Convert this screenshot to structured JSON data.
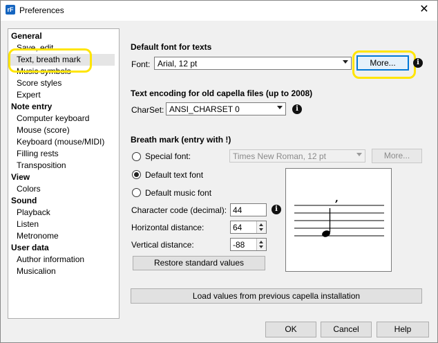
{
  "window": {
    "title": "Preferences",
    "app_icon_text": "rF"
  },
  "nav": {
    "groups": [
      {
        "label": "General",
        "items": [
          "Save, edit",
          "Text, breath mark",
          "Music symbols",
          "Score styles",
          "Expert"
        ]
      },
      {
        "label": "Note entry",
        "items": [
          "Computer keyboard",
          "Mouse (score)",
          "Keyboard (mouse/MIDI)",
          "Filling rests",
          "Transposition"
        ]
      },
      {
        "label": "View",
        "items": [
          "Colors"
        ]
      },
      {
        "label": "Sound",
        "items": [
          "Playback",
          "Listen",
          "Metronome"
        ]
      },
      {
        "label": "User data",
        "items": [
          "Author information",
          "Musicalion"
        ]
      }
    ],
    "selected": "Text, breath mark"
  },
  "default_font": {
    "title": "Default font for texts",
    "font_label": "Font:",
    "font_value": "Arial, 12 pt",
    "more_label": "More..."
  },
  "encoding": {
    "title": "Text encoding for old capella files (up to 2008)",
    "charset_label": "CharSet:",
    "charset_value": "ANSI_CHARSET 0"
  },
  "breath": {
    "title": "Breath mark (entry with !)",
    "special_font_label": "Special font:",
    "special_font_value": "Times New Roman, 12 pt",
    "more_label": "More...",
    "default_text_label": "Default text font",
    "default_music_label": "Default music font",
    "char_code_label": "Character code (decimal):",
    "char_code_value": "44",
    "hdist_label": "Horizontal distance:",
    "hdist_value": "64",
    "vdist_label": "Vertical distance:",
    "vdist_value": "-88",
    "restore_label": "Restore standard values",
    "preview_mark": ","
  },
  "load_label": "Load values from previous capella installation",
  "footer": {
    "ok": "OK",
    "cancel": "Cancel",
    "help": "Help"
  },
  "colors": {
    "highlight": "#ffe500",
    "focus": "#0078d7"
  }
}
